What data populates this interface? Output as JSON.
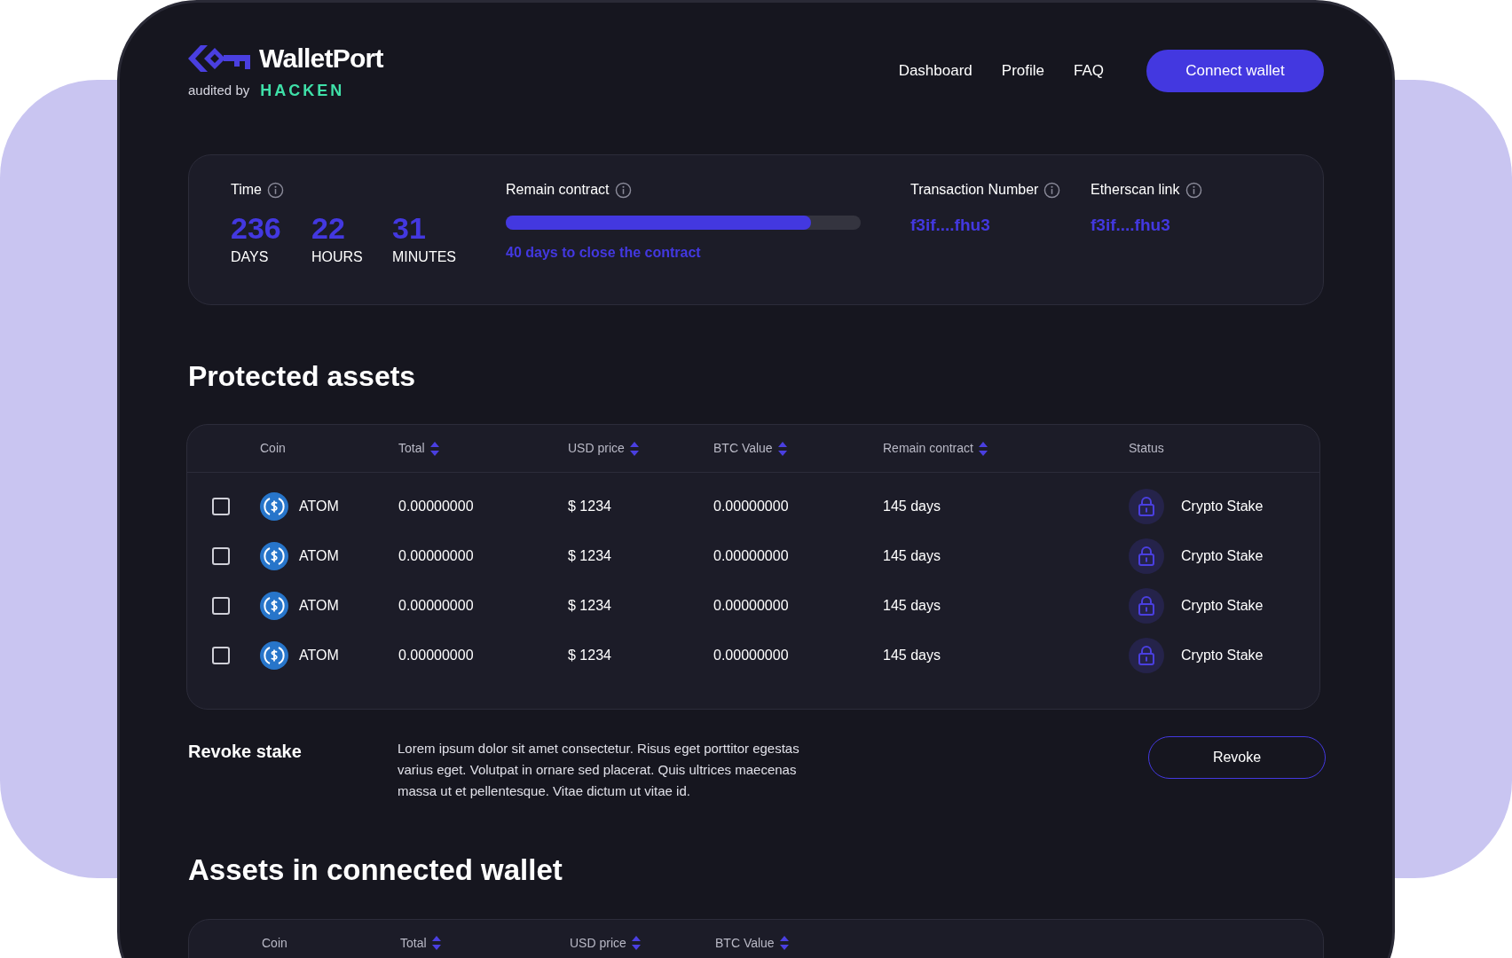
{
  "header": {
    "brand": "WalletPort",
    "audited_label": "audited by",
    "auditor": "HACKEN",
    "nav": [
      "Dashboard",
      "Profile",
      "FAQ"
    ],
    "connect_button": "Connect wallet"
  },
  "stats": {
    "time": {
      "label": "Time",
      "units": [
        {
          "value": "236",
          "label": "DAYS"
        },
        {
          "value": "22",
          "label": "HOURS"
        },
        {
          "value": "31",
          "label": "MINUTES"
        }
      ]
    },
    "remain_contract": {
      "label": "Remain contract",
      "level": 0.86,
      "caption": "40 days to close the contract"
    },
    "transaction": {
      "label": "Transaction Number",
      "value": "f3if....fhu3"
    },
    "etherscan": {
      "label": "Etherscan link",
      "value": "f3if....fhu3"
    }
  },
  "protected_assets": {
    "title": "Protected assets",
    "columns": [
      {
        "label": "Coin",
        "sortable": false
      },
      {
        "label": "Total",
        "sortable": true
      },
      {
        "label": "USD price",
        "sortable": true
      },
      {
        "label": "BTC Value",
        "sortable": true
      },
      {
        "label": "Remain contract",
        "sortable": true
      },
      {
        "label": "Status",
        "sortable": false
      }
    ],
    "rows": [
      {
        "checked": false,
        "coin": "ATOM",
        "total": "0.00000000",
        "usd_price": "$ 1234",
        "btc_value": "0.00000000",
        "remain": "145 days",
        "status": "Crypto Stake"
      },
      {
        "checked": false,
        "coin": "ATOM",
        "total": "0.00000000",
        "usd_price": "$ 1234",
        "btc_value": "0.00000000",
        "remain": "145 days",
        "status": "Crypto Stake"
      },
      {
        "checked": false,
        "coin": "ATOM",
        "total": "0.00000000",
        "usd_price": "$ 1234",
        "btc_value": "0.00000000",
        "remain": "145 days",
        "status": "Crypto Stake"
      },
      {
        "checked": false,
        "coin": "ATOM",
        "total": "0.00000000",
        "usd_price": "$ 1234",
        "btc_value": "0.00000000",
        "remain": "145 days",
        "status": "Crypto Stake"
      }
    ]
  },
  "revoke": {
    "title": "Revoke stake",
    "text": "Lorem ipsum dolor sit amet consectetur. Risus eget porttitor egestas varius eget. Volutpat in ornare sed placerat. Quis ultrices maecenas massa ut et pellentesque. Vitae dictum ut vitae id.",
    "button": "Revoke"
  },
  "wallet_assets": {
    "title": "Assets in connected wallet",
    "columns": [
      {
        "label": "Coin",
        "sortable": false
      },
      {
        "label": "Total",
        "sortable": true
      },
      {
        "label": "USD price",
        "sortable": true
      },
      {
        "label": "BTC Value",
        "sortable": true
      }
    ]
  }
}
